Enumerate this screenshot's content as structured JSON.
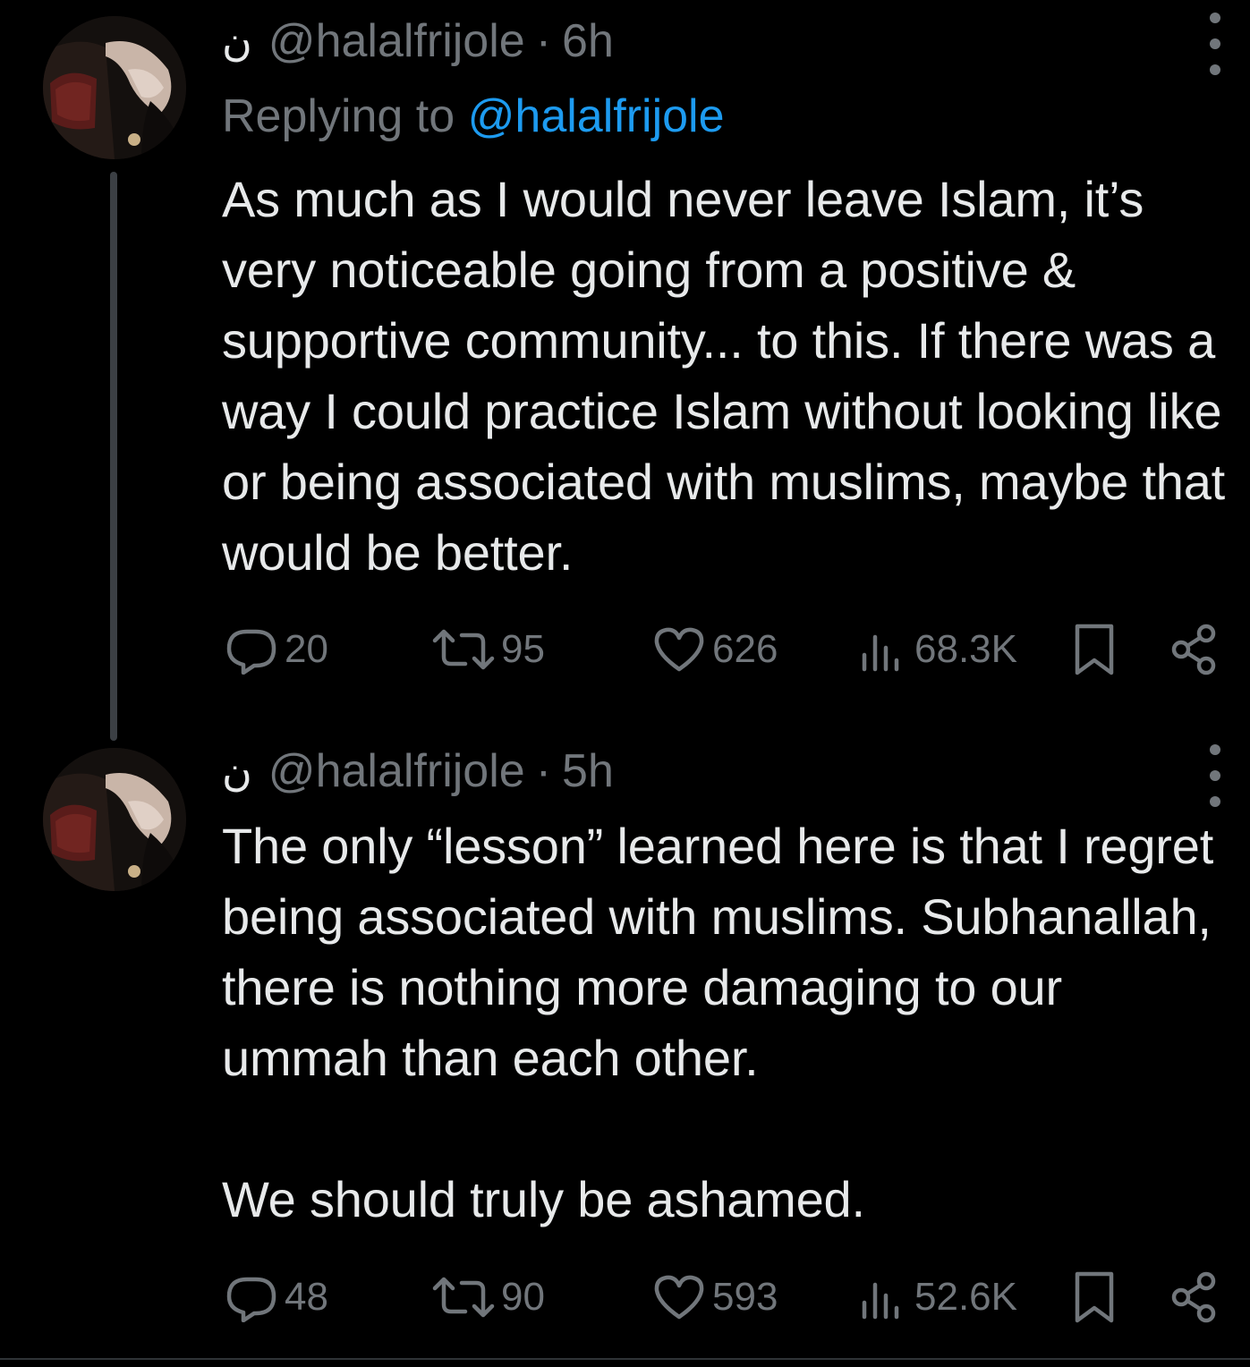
{
  "tweets": [
    {
      "display_name": "ن",
      "handle": "@halalfrijole",
      "separator": "·",
      "time": "6h",
      "replying_prefix": "Replying to",
      "replying_handle": "@halalfrijole",
      "text": "As much as I would never leave Islam, it’s very noticeable going from a positive & supportive community... to this. If there was a way I could practice Islam without looking like or being associated with muslims, maybe that would be better.",
      "replies": "20",
      "reposts": "95",
      "likes": "626",
      "views": "68.3K"
    },
    {
      "display_name": "ن",
      "handle": "@halalfrijole",
      "separator": "·",
      "time": "5h",
      "text": "The only “lesson” learned here is that I regret being associated with muslims. Subhanallah, there is nothing more damaging to our ummah than each other.\n\nWe should truly be ashamed.",
      "replies": "48",
      "reposts": "90",
      "likes": "593",
      "views": "52.6K"
    }
  ],
  "icons": {
    "reply": "reply-icon",
    "repost": "repost-icon",
    "like": "heart-icon",
    "views": "views-icon",
    "bookmark": "bookmark-icon",
    "share": "share-icon",
    "more": "more-vertical-icon"
  },
  "colors": {
    "background": "#000000",
    "text": "#e7e9ea",
    "muted": "#71767b",
    "link": "#1d9bf0",
    "thread_line": "#3b3f44"
  }
}
